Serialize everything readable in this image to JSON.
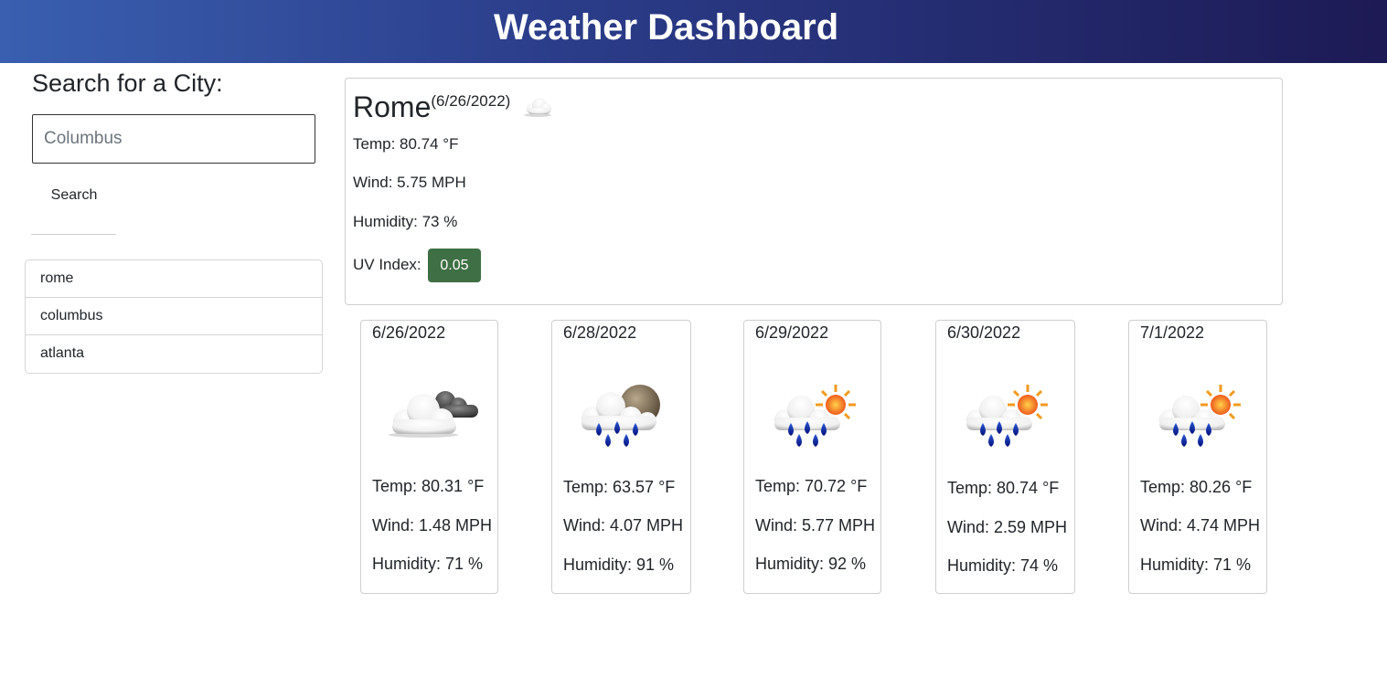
{
  "header": {
    "title": "Weather Dashboard"
  },
  "search": {
    "title": "Search for a City:",
    "placeholder": "Columbus",
    "button_label": "Search"
  },
  "history": [
    "rome",
    "columbus",
    "atlanta"
  ],
  "current": {
    "city": "Rome",
    "date": "(6/26/2022)",
    "icon": "cloud-icon",
    "temp": "Temp: 80.74 °F",
    "wind": "Wind: 5.75 MPH",
    "humidity": "Humidity: 73 %",
    "uv_label": "UV Index:",
    "uv_value": "0.05",
    "uv_color": "#3f6f44"
  },
  "forecast": [
    {
      "date": "6/26/2022",
      "icon": "broken-clouds-icon",
      "temp": "Temp: 80.31 °F",
      "wind": "Wind: 1.48 MPH",
      "humidity": "Humidity: 71 %"
    },
    {
      "date": "6/28/2022",
      "icon": "rain-night-icon",
      "temp": "Temp: 63.57 °F",
      "wind": "Wind: 4.07 MPH",
      "humidity": "Humidity: 91 %"
    },
    {
      "date": "6/29/2022",
      "icon": "rain-sun-icon",
      "temp": "Temp: 70.72 °F",
      "wind": "Wind: 5.77 MPH",
      "humidity": "Humidity: 92 %"
    },
    {
      "date": "6/30/2022",
      "icon": "rain-sun-icon",
      "temp": "Temp: 80.74 °F",
      "wind": "Wind: 2.59 MPH",
      "humidity": "Humidity: 74 %"
    },
    {
      "date": "7/1/2022",
      "icon": "rain-sun-icon",
      "temp": "Temp: 80.26 °F",
      "wind": "Wind: 4.74 MPH",
      "humidity": "Humidity: 71 %"
    }
  ]
}
